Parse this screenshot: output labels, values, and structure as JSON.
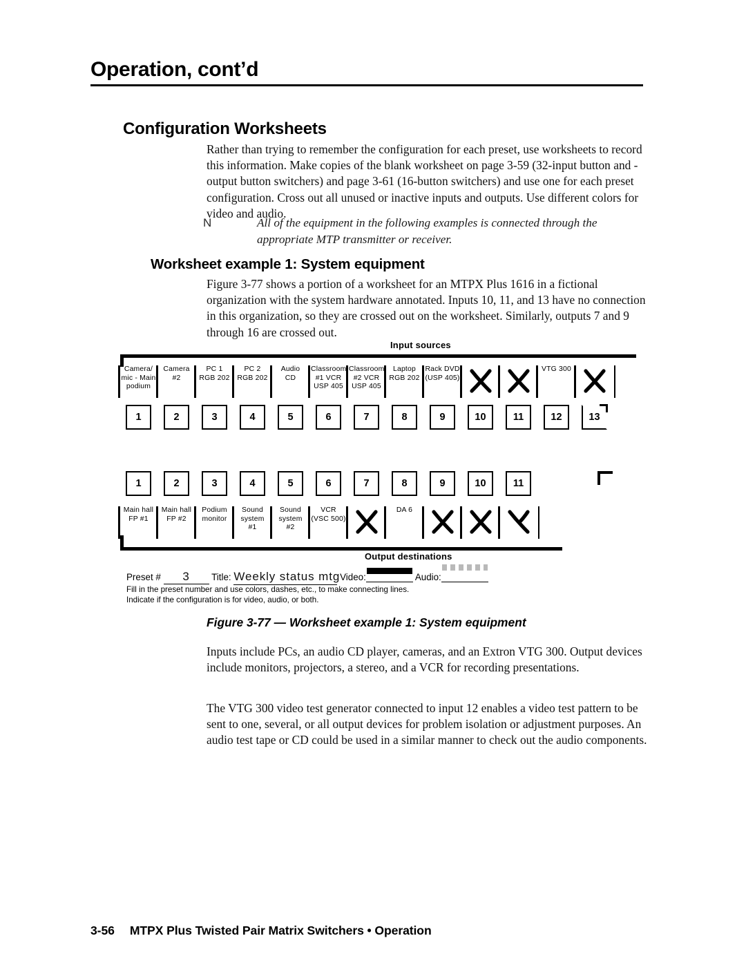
{
  "header": {
    "running_title": "Operation, cont’d"
  },
  "headings": {
    "section": "Configuration Worksheets",
    "subsection": "Worksheet example 1: System equipment"
  },
  "paragraphs": {
    "intro": "Rather than trying to remember the configuration for each preset, use worksheets to record this information.  Make copies of the blank worksheet on page 3-59 (32-input button and -output button switchers) and page 3-61 (16-button switchers) and use one for each preset configuration.  Cross out all unused or inactive inputs and outputs.  Use different colors for video and audio.",
    "figure_intro": "Figure 3-77 shows a portion of a worksheet for an MTPX Plus 1616 in a fictional organization with the system hardware annotated.  Inputs 10, 11, and 13 have no connection in this organization, so they are crossed out on the worksheet.  Similarly, outputs 7 and 9 through 16 are crossed out.",
    "inputs_include": "Inputs include PCs, an audio CD player, cameras, and an Extron VTG 300.  Output devices include monitors, projectors, a stereo, and a VCR for recording presentations.",
    "vtg": "The VTG 300 video test generator connected to input 12 enables a video test pattern to be sent to one, several, or all output devices for problem isolation or adjustment purposes.  An audio test tape or CD could be used in a similar manner to check out the audio components."
  },
  "note": {
    "icon": "N",
    "text": "All of the equipment in the following examples is connected through the appropriate MTP transmitter or receiver."
  },
  "figure": {
    "caption": "Figure 3-77 — Worksheet example 1: System equipment",
    "input_band_label": "Input  sources",
    "output_band_label": "Output destinations",
    "inputs": [
      {
        "number": "1",
        "label": "Camera/\nmic - Main\npodium",
        "crossed": false
      },
      {
        "number": "2",
        "label": "Camera\n#2",
        "crossed": false
      },
      {
        "number": "3",
        "label": "PC 1\nRGB 202",
        "crossed": false
      },
      {
        "number": "4",
        "label": "PC 2\nRGB 202",
        "crossed": false
      },
      {
        "number": "5",
        "label": "Audio\nCD",
        "crossed": false
      },
      {
        "number": "6",
        "label": "Classroom\n#1 VCR\nUSP 405",
        "crossed": false
      },
      {
        "number": "7",
        "label": "Classroom\n#2 VCR\nUSP 405",
        "crossed": false
      },
      {
        "number": "8",
        "label": "Laptop\nRGB 202",
        "crossed": false
      },
      {
        "number": "9",
        "label": "Rack DVD\n(USP 405)",
        "crossed": false
      },
      {
        "number": "10",
        "label": "",
        "crossed": true
      },
      {
        "number": "11",
        "label": "",
        "crossed": true
      },
      {
        "number": "12",
        "label": "VTG 300",
        "crossed": false
      },
      {
        "number": "13",
        "label": "",
        "crossed": true
      }
    ],
    "outputs": [
      {
        "number": "1",
        "label": "Main hall\nFP #1",
        "crossed": false
      },
      {
        "number": "2",
        "label": "Main hall\nFP #2",
        "crossed": false
      },
      {
        "number": "3",
        "label": "Podium\nmonitor",
        "crossed": false
      },
      {
        "number": "4",
        "label": "Sound\nsystem\n#1",
        "crossed": false
      },
      {
        "number": "5",
        "label": "Sound\nsystem\n#2",
        "crossed": false
      },
      {
        "number": "6",
        "label": "VCR\n(VSC 500)",
        "crossed": false
      },
      {
        "number": "7",
        "label": "",
        "crossed": true
      },
      {
        "number": "8",
        "label": "DA 6",
        "crossed": false
      },
      {
        "number": "9",
        "label": "",
        "crossed": true
      },
      {
        "number": "10",
        "label": "",
        "crossed": true
      },
      {
        "number": "11",
        "label": "",
        "crossed": "partial"
      }
    ],
    "preset_line": {
      "preset_label": "Preset #",
      "preset_value": "3",
      "title_label": "Title:",
      "title_value": "Weekly status mtg",
      "video_label": "Video:",
      "audio_label": "Audio:"
    },
    "fine_print_1": "Fill in the preset number and use colors, dashes, etc., to make connecting lines.",
    "fine_print_2": "Indicate if the configuration is for video, audio, or both."
  },
  "footer": {
    "page_number": "3-56",
    "text": "MTPX Plus Twisted Pair Matrix Switchers • Operation"
  }
}
